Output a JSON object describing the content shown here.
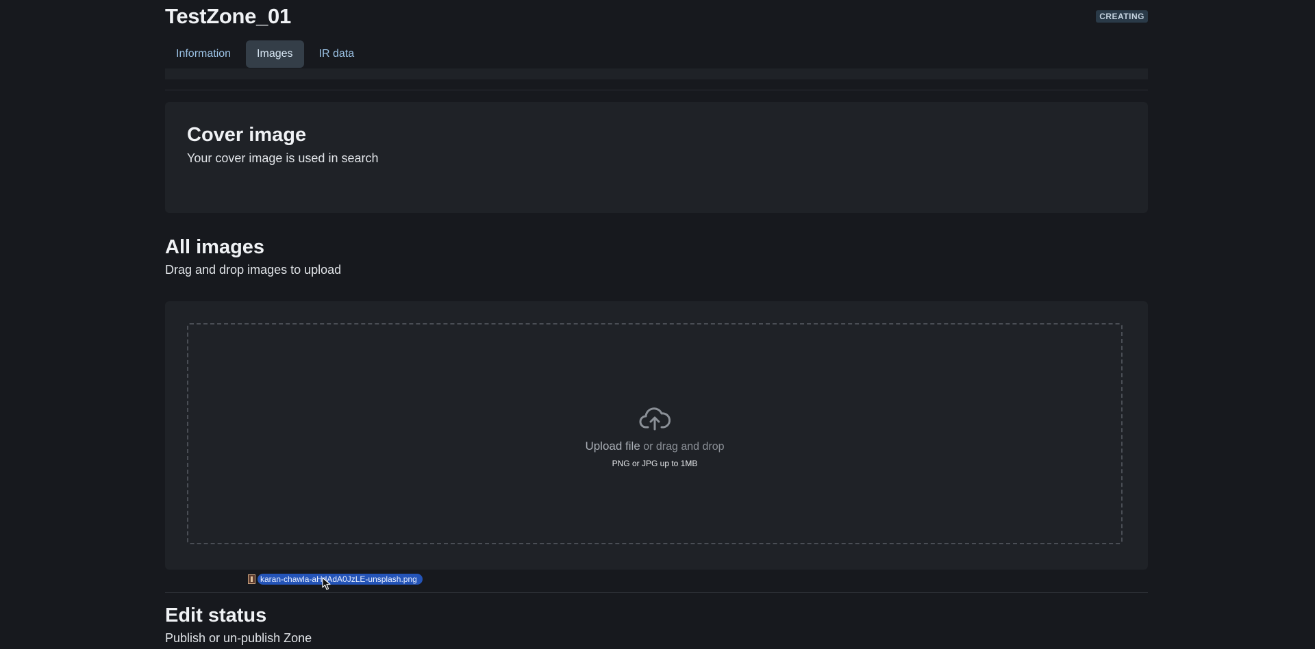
{
  "header": {
    "zone_title": "TestZone_01",
    "status_badge": "CREATING"
  },
  "tabs": [
    {
      "label": "Information",
      "active": false
    },
    {
      "label": "Images",
      "active": true
    },
    {
      "label": "IR data",
      "active": false
    }
  ],
  "cover_image": {
    "title": "Cover image",
    "subtitle": "Your cover image is used in search"
  },
  "all_images": {
    "title": "All images",
    "subtitle": "Drag and drop images to upload",
    "dropzone": {
      "icon": "cloud-upload-icon",
      "upload_link": "Upload file",
      "upload_rest": " or drag and drop",
      "hint": "PNG or JPG up to 1MB"
    }
  },
  "drag_ghost": {
    "file_name": "karan-chawla-aHdAdA0JzLE-unsplash.png",
    "icon": "image-file-icon"
  },
  "edit_status": {
    "title": "Edit status",
    "subtitle": "Publish or un-publish Zone"
  }
}
